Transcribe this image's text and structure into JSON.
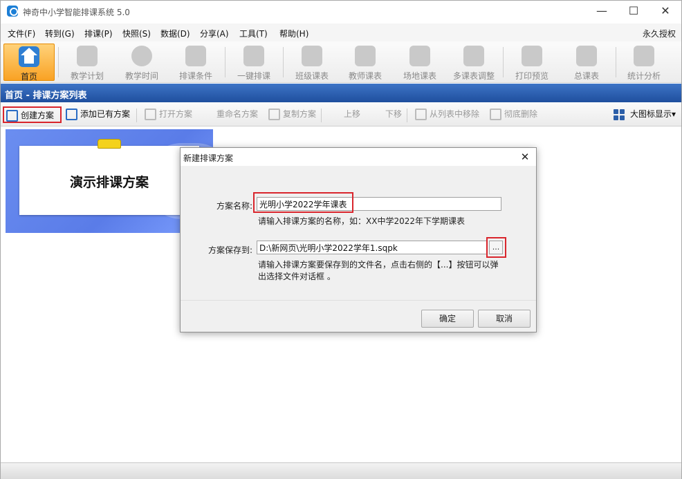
{
  "window": {
    "title": "神奇中小学智能排课系统 5.0",
    "minimize": "—",
    "maximize": "☐",
    "close": "✕"
  },
  "menu": [
    "文件(F)",
    "转到(G)",
    "排课(P)",
    "快照(S)",
    "数据(D)",
    "分享(A)",
    "工具(T)",
    "帮助(H)"
  ],
  "license": "永久授权",
  "bigbar": [
    "首页",
    "教学计划",
    "教学时间",
    "排课条件",
    "一键排课",
    "班级课表",
    "教师课表",
    "场地课表",
    "多课表调整",
    "打印预览",
    "总课表",
    "统计分析"
  ],
  "section_title": "首页 - 排课方案列表",
  "toolbar": {
    "create": "创建方案",
    "add_existing": "添加已有方案",
    "open": "打开方案",
    "rename": "重命名方案",
    "copy": "复制方案",
    "up": "上移",
    "down": "下移",
    "remove": "从列表中移除",
    "delete": "彻底删除",
    "view": "大图标显示▾"
  },
  "card": {
    "title": "演示排课方案"
  },
  "dialog": {
    "title": "新建排课方案",
    "name_label": "方案名称:",
    "name_value": "光明小学2022学年课表",
    "name_hint": "请输入排课方案的名称，如：XX中学2022年下学期课表",
    "path_label": "方案保存到:",
    "path_value": "D:\\新网页\\光明小学2022学年1.sqpk",
    "browse": "...",
    "path_hint_1": "请输入排课方案要保存到的文件名，点击右侧的【...】按钮可以弹",
    "path_hint_2": "出选择文件对话框 。",
    "ok": "确定",
    "cancel": "取消"
  },
  "colors": {
    "accent": "#2a6cc4",
    "highlight": "#d9252c",
    "active_tab": "#f9a224",
    "section_bar": "#1f4f9e"
  }
}
